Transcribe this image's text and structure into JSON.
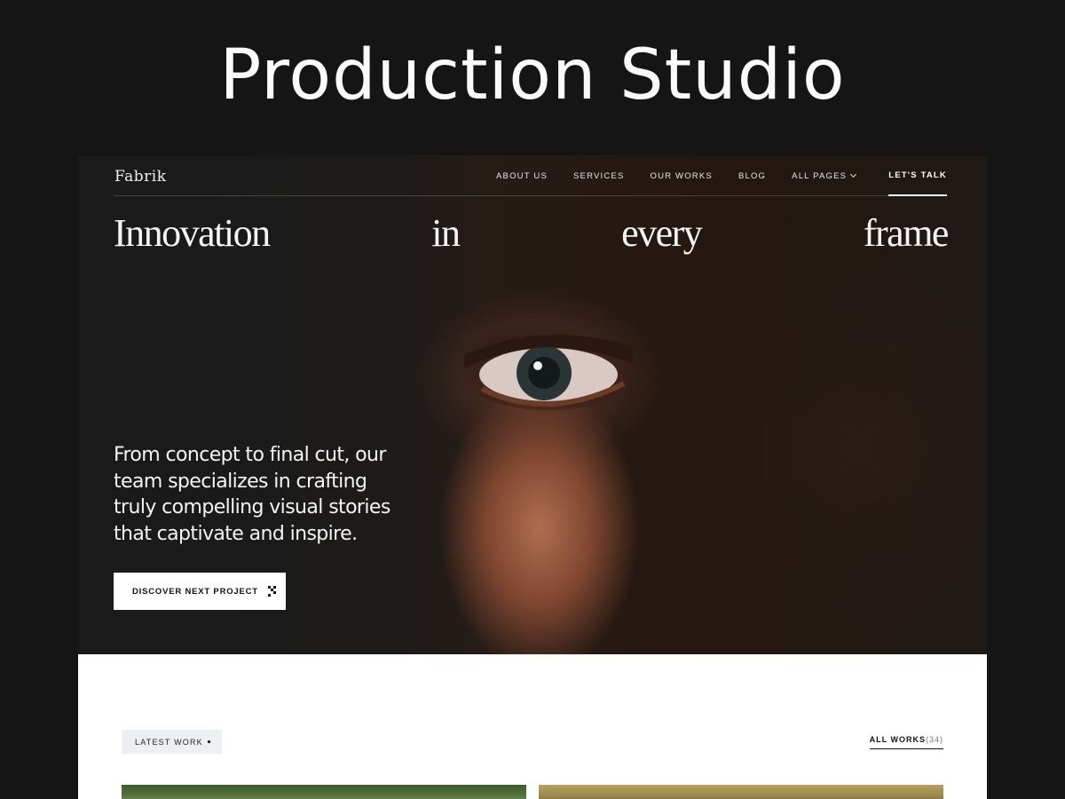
{
  "showcase": {
    "title": "Production Studio"
  },
  "nav": {
    "logo": "Fabrik",
    "links": [
      "ABOUT US",
      "SERVICES",
      "OUR WORKS",
      "BLOG",
      "ALL PAGES"
    ],
    "cta": "LET'S TALK"
  },
  "hero": {
    "headline_words": [
      "Innovation",
      "in",
      "every",
      "frame"
    ],
    "tagline": "From concept to final cut, our team specializes in crafting truly compelling visual stories that captivate and inspire.",
    "button": "DISCOVER NEXT PROJECT"
  },
  "works": {
    "badge": "LATEST WORK",
    "all_label": "ALL WORKS",
    "count": "(34)"
  },
  "colors": {
    "page_bg": "#151515",
    "button_bg": "#ffffff",
    "badge_bg": "#edf0f3"
  }
}
